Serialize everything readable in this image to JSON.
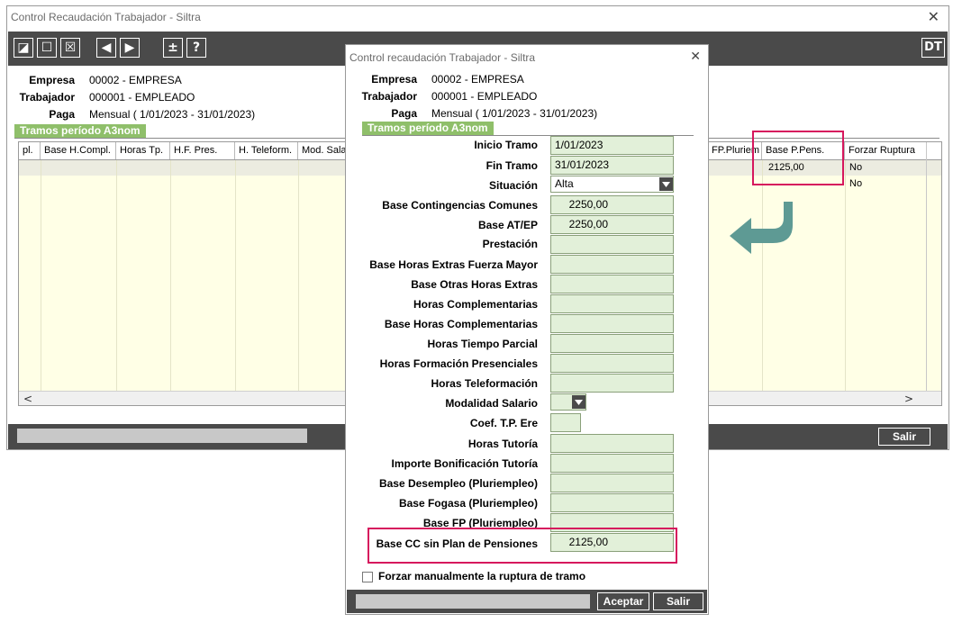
{
  "main_window": {
    "title": "Control Recaudación Trabajador - Siltra",
    "close_glyph": "✕",
    "toolbar": {
      "icons": [
        "edit-icon",
        "new-icon",
        "delete-icon",
        "prev-icon",
        "next-icon",
        "plusminus-icon",
        "help-icon"
      ],
      "glyphs": [
        "◪",
        "☐",
        "☒",
        "◀",
        "▶",
        "±",
        "?"
      ],
      "dt_label": "DT"
    },
    "header": {
      "empresa_label": "Empresa",
      "empresa_value": "00002 - EMPRESA",
      "trabajador_label": "Trabajador",
      "trabajador_value": "000001 - EMPLEADO",
      "paga_label": "Paga",
      "paga_value": "Mensual ( 1/01/2023 - 31/01/2023)"
    },
    "tab_label": "Tramos período A3nom",
    "grid": {
      "columns_left": [
        "pl.",
        "Base H.Compl.",
        "Horas Tp.",
        "H.F. Pres.",
        "H. Teleform.",
        "Mod. Sala"
      ],
      "columns_right": [
        "FP.Pluriem",
        "Base P.Pens.",
        "Forzar Ruptura"
      ],
      "rows": [
        {
          "base_p_pens": "2125,00",
          "forzar_ruptura": "No"
        },
        {
          "base_p_pens": "",
          "forzar_ruptura": "No"
        }
      ],
      "scroll_left": "<",
      "scroll_right": ">"
    },
    "exit_button": "Salir"
  },
  "dialog": {
    "title": "Control recaudación Trabajador - Siltra",
    "close_glyph": "✕",
    "header": {
      "empresa_label": "Empresa",
      "empresa_value": "00002 - EMPRESA",
      "trabajador_label": "Trabajador",
      "trabajador_value": "000001 - EMPLEADO",
      "paga_label": "Paga",
      "paga_value": "Mensual ( 1/01/2023 - 31/01/2023)"
    },
    "tab_label": "Tramos período A3nom",
    "fields": [
      {
        "label": "Inicio Tramo",
        "value": "1/01/2023"
      },
      {
        "label": "Fin Tramo",
        "value": "31/01/2023"
      },
      {
        "label": "Situación",
        "value": "Alta"
      },
      {
        "label": "Base Contingencias Comunes",
        "value": "2250,00"
      },
      {
        "label": "Base AT/EP",
        "value": "2250,00"
      },
      {
        "label": "Prestación",
        "value": ""
      },
      {
        "label": "Base Horas Extras Fuerza Mayor",
        "value": ""
      },
      {
        "label": "Base Otras Horas Extras",
        "value": ""
      },
      {
        "label": "Horas Complementarias",
        "value": ""
      },
      {
        "label": "Base Horas Complementarias",
        "value": ""
      },
      {
        "label": "Horas Tiempo Parcial",
        "value": ""
      },
      {
        "label": "Horas Formación Presenciales",
        "value": ""
      },
      {
        "label": "Horas Teleformación",
        "value": ""
      },
      {
        "label": "Modalidad Salario",
        "value": ""
      },
      {
        "label": "Coef. T.P. Ere",
        "value": ""
      },
      {
        "label": "Horas Tutoría",
        "value": ""
      },
      {
        "label": "Importe Bonificación Tutoría",
        "value": ""
      },
      {
        "label": "Base Desempleo (Pluriempleo)",
        "value": ""
      },
      {
        "label": "Base Fogasa (Pluriempleo)",
        "value": ""
      },
      {
        "label": "Base FP (Pluriempleo)",
        "value": ""
      },
      {
        "label": "Base CC sin Plan de Pensiones",
        "value": "2125,00"
      }
    ],
    "checkbox_label": "Forzar manualmente la ruptura de tramo",
    "accept_button": "Aceptar",
    "exit_button": "Salir"
  },
  "colors": {
    "accent_highlight": "#d6175d",
    "field_bg": "#e2f0d9",
    "tab_green": "#8fbf6a",
    "arrow": "#5e9a94",
    "toolbar": "#4a4a4a"
  }
}
